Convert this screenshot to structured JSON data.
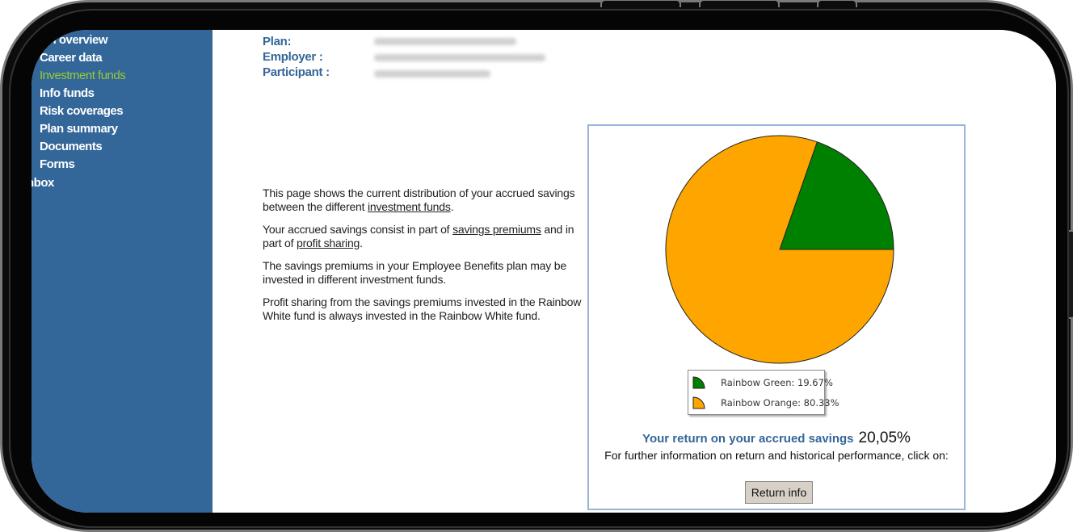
{
  "sidebar": {
    "items": [
      {
        "label": "lan overview",
        "active": false
      },
      {
        "label": "Career data",
        "active": false
      },
      {
        "label": "Investment funds",
        "active": true
      },
      {
        "label": "Info funds",
        "active": false
      },
      {
        "label": "Risk coverages",
        "active": false
      },
      {
        "label": "Plan summary",
        "active": false
      },
      {
        "label": "Documents",
        "active": false
      },
      {
        "label": "Forms",
        "active": false
      },
      {
        "label": "nbox",
        "active": false
      }
    ]
  },
  "header_info": {
    "plan_label": "Plan:",
    "employer_label": "Employer :",
    "participant_label": "Participant :"
  },
  "intro": {
    "p1_before": "This page shows the current distribution of your accrued savings between the different ",
    "p1_link": "investment funds",
    "p1_after": ".",
    "p2_before": "Your accrued savings consist in part of ",
    "p2_link1": "savings premiums",
    "p2_mid": " and in part of ",
    "p2_link2": "profit sharing",
    "p2_after": ".",
    "p3": "The savings premiums in your Employee Benefits plan may be invested in different investment funds.",
    "p4": "Profit sharing from the savings premiums invested in the Rainbow White fund is always invested in the Rainbow White fund."
  },
  "chart_data": {
    "type": "pie",
    "slices": [
      {
        "name": "Rainbow Green",
        "value": 19.67,
        "label": "Rainbow Green: 19.67%",
        "color": "#008000"
      },
      {
        "name": "Rainbow Orange",
        "value": 80.33,
        "label": "Rainbow Orange: 80.33%",
        "color": "#FFA500"
      }
    ],
    "legend_position": "bottom"
  },
  "return_info": {
    "label": "Your return on your accrued savings",
    "value": "20,05%",
    "further": "For further information on return and historical performance, click on:",
    "button": "Return info"
  }
}
